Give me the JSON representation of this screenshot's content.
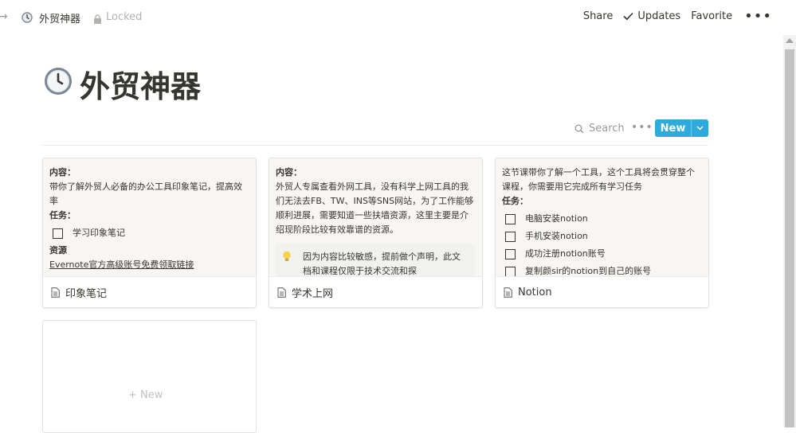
{
  "breadcrumb": {
    "title": "外贸神器",
    "locked": "Locked"
  },
  "topbar": {
    "share": "Share",
    "updates": "Updates",
    "favorite": "Favorite",
    "more": "•••"
  },
  "page": {
    "title": "外贸神器",
    "icon": "clock-icon"
  },
  "database": {
    "search": "Search",
    "more": "•••",
    "new_button": "New",
    "add_new_card": "+ New"
  },
  "cards": [
    {
      "title": "印象笔记",
      "content_heading": "内容：",
      "content_text": "带你了解外贸人必备的办公工具印象笔记，提高效率",
      "task_heading": "任务：",
      "todos": [
        "学习印象笔记"
      ],
      "resource_heading": "资源",
      "link_text": "Evernote官方高级账号免费领取链接"
    },
    {
      "title": "学术上网",
      "content_heading": "内容：",
      "content_text": "外贸人专属查看外网工具，没有科学上网工具的我们无法去FB、TW、INS等SNS网站，为了工作能够顺利进展，需要知道一些扶墙资源，这里主要是介绍现阶段比较有效靠谱的资源。",
      "callout_text": "因为内容比较敏感，提前做个声明，此文档和课程仅限于技术交流和探",
      "callout_icon": "lightbulb-icon"
    },
    {
      "title": "Notion",
      "content_text": "这节课带你了解一个工具，这个工具将会贯穿整个课程，你需要用它完成所有学习任务",
      "task_heading": "任务：",
      "todos": [
        "电脑安装notion",
        "手机安装notion",
        "成功注册notion账号",
        "复制颜sir的notion到自己的账号"
      ]
    }
  ],
  "colors": {
    "accent": "#2eaadc",
    "text": "#37352f",
    "muted": "#9b9a97",
    "preview_bg": "#f7f6f3"
  }
}
